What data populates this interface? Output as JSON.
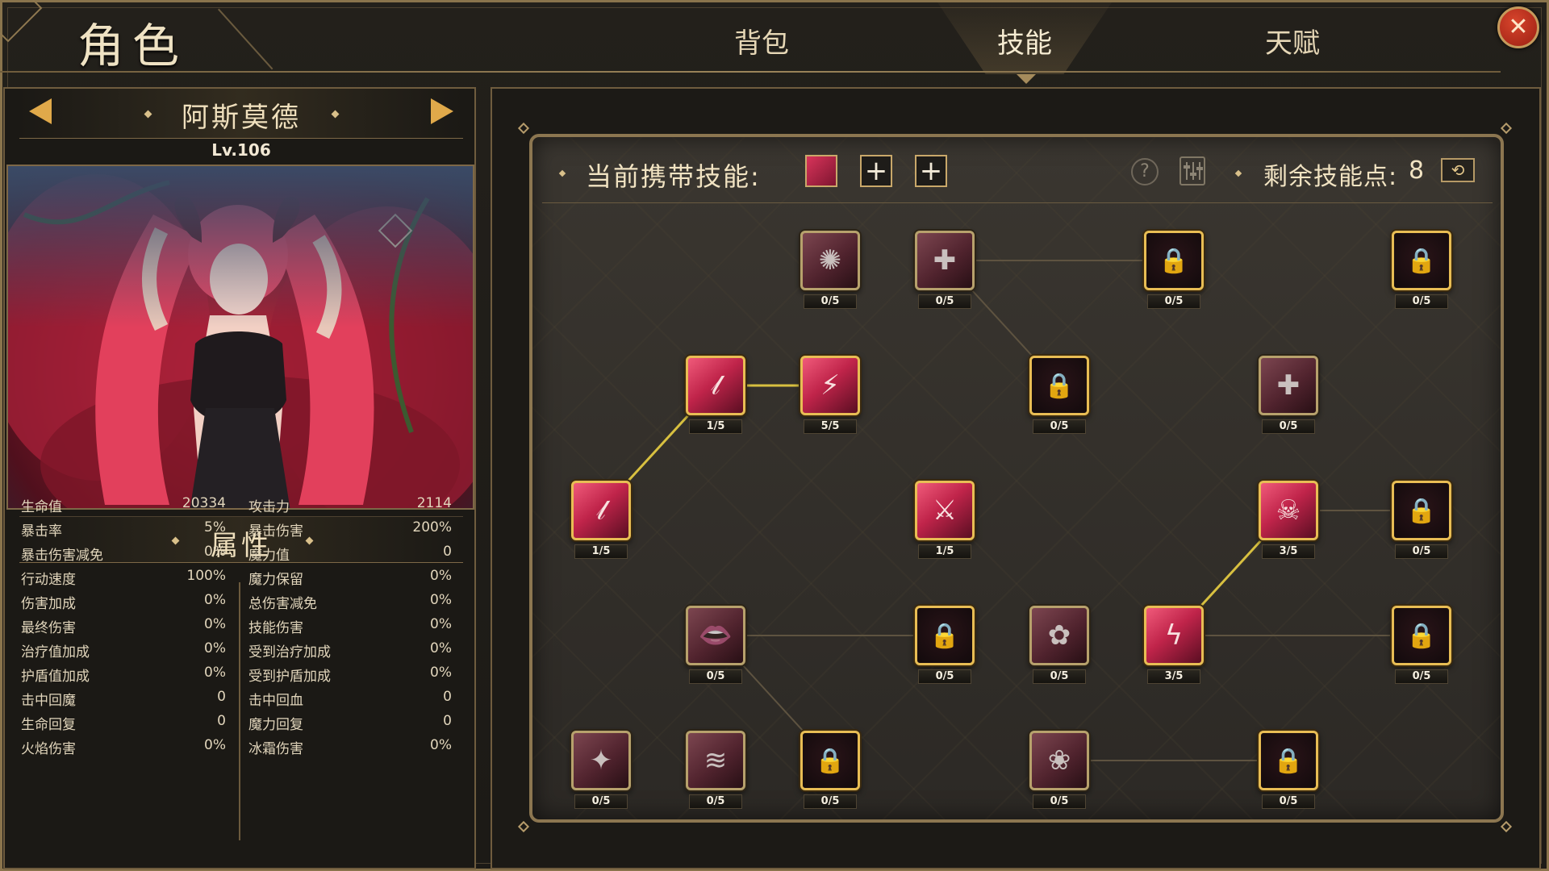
{
  "header": {
    "title": "角色",
    "tabs": [
      {
        "label": "背包"
      },
      {
        "label": "技能"
      },
      {
        "label": "天赋"
      }
    ],
    "active_tab": "技能"
  },
  "character": {
    "name": "阿斯莫德",
    "level": "Lv.106"
  },
  "attributes": {
    "title": "属性",
    "left": [
      {
        "k": "生命值",
        "v": "20334"
      },
      {
        "k": "暴击率",
        "v": "5%"
      },
      {
        "k": "暴击伤害减免",
        "v": "0%"
      },
      {
        "k": "行动速度",
        "v": "100%"
      },
      {
        "k": "伤害加成",
        "v": "0%"
      },
      {
        "k": "最终伤害",
        "v": "0%"
      },
      {
        "k": "治疗值加成",
        "v": "0%"
      },
      {
        "k": "护盾值加成",
        "v": "0%"
      },
      {
        "k": "击中回魔",
        "v": "0"
      },
      {
        "k": "生命回复",
        "v": "0"
      },
      {
        "k": "火焰伤害",
        "v": "0%"
      }
    ],
    "right": [
      {
        "k": "攻击力",
        "v": "2114"
      },
      {
        "k": "暴击伤害",
        "v": "200%"
      },
      {
        "k": "魔力值",
        "v": "0"
      },
      {
        "k": "魔力保留",
        "v": "0%"
      },
      {
        "k": "总伤害减免",
        "v": "0%"
      },
      {
        "k": "技能伤害",
        "v": "0%"
      },
      {
        "k": "受到治疗加成",
        "v": "0%"
      },
      {
        "k": "受到护盾加成",
        "v": "0%"
      },
      {
        "k": "击中回血",
        "v": "0"
      },
      {
        "k": "魔力回复",
        "v": "0"
      },
      {
        "k": "冰霜伤害",
        "v": "0%"
      }
    ]
  },
  "skills": {
    "carry_label": "当前携带技能:",
    "points_label": "剩余技能点:",
    "points_value": "8",
    "help_glyph": "?",
    "reset_glyph": "⟲",
    "add_glyph": "+",
    "nodes": [
      {
        "id": "r1c3",
        "level": "0/5",
        "state": "dim",
        "glyph": "✺"
      },
      {
        "id": "r1c4",
        "level": "0/5",
        "state": "dim",
        "glyph": "✚"
      },
      {
        "id": "r1c6",
        "level": "0/5",
        "state": "locked",
        "glyph": "🔒"
      },
      {
        "id": "r1c8",
        "level": "0/5",
        "state": "locked",
        "glyph": "🔒"
      },
      {
        "id": "r2c2",
        "level": "1/5",
        "state": "unlocked",
        "glyph": "𝓁"
      },
      {
        "id": "r2c3",
        "level": "5/5",
        "state": "unlocked",
        "glyph": "⚡"
      },
      {
        "id": "r2c5",
        "level": "0/5",
        "state": "locked",
        "glyph": "🔒"
      },
      {
        "id": "r2c7",
        "level": "0/5",
        "state": "dim",
        "glyph": "✚"
      },
      {
        "id": "r3c1",
        "level": "1/5",
        "state": "unlocked",
        "glyph": "𝓁"
      },
      {
        "id": "r3c4",
        "level": "1/5",
        "state": "unlocked",
        "glyph": "⚔"
      },
      {
        "id": "r3c7",
        "level": "3/5",
        "state": "unlocked",
        "glyph": "☠"
      },
      {
        "id": "r3c8",
        "level": "0/5",
        "state": "locked",
        "glyph": "🔒"
      },
      {
        "id": "r4c2",
        "level": "0/5",
        "state": "dim",
        "glyph": "👄"
      },
      {
        "id": "r4c4",
        "level": "0/5",
        "state": "locked",
        "glyph": "🔒"
      },
      {
        "id": "r4c5",
        "level": "0/5",
        "state": "dim",
        "glyph": "✿"
      },
      {
        "id": "r4c6",
        "level": "3/5",
        "state": "unlocked",
        "glyph": "ϟ"
      },
      {
        "id": "r4c8",
        "level": "0/5",
        "state": "locked",
        "glyph": "🔒"
      },
      {
        "id": "r5c1",
        "level": "0/5",
        "state": "dim",
        "glyph": "✦"
      },
      {
        "id": "r5c2",
        "level": "0/5",
        "state": "dim",
        "glyph": "≋"
      },
      {
        "id": "r5c3",
        "level": "0/5",
        "state": "locked",
        "glyph": "🔒"
      },
      {
        "id": "r5c5",
        "level": "0/5",
        "state": "dim",
        "glyph": "❀"
      },
      {
        "id": "r5c7",
        "level": "0/5",
        "state": "locked",
        "glyph": "🔒"
      }
    ]
  },
  "colors": {
    "accent_gold": "#e8bd54",
    "active_link": "#d8c040",
    "inactive_link": "#5e5340"
  }
}
